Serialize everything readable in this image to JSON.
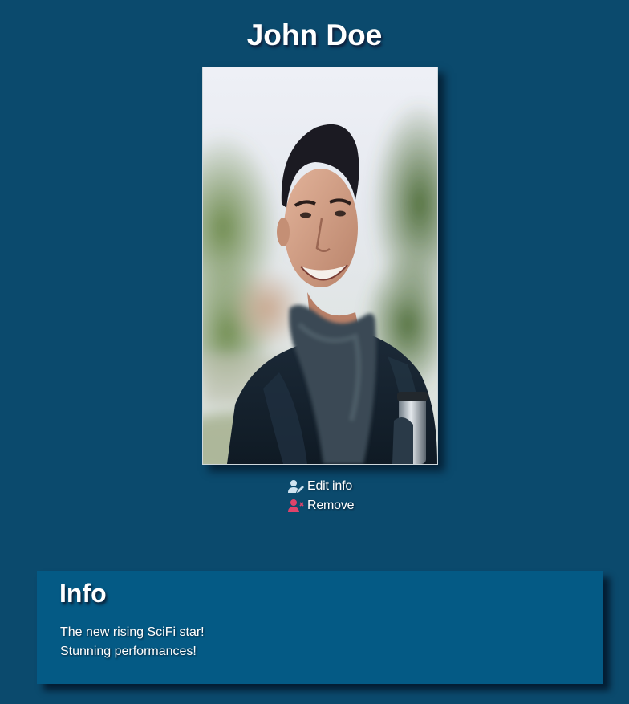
{
  "profile": {
    "name": "John Doe",
    "photo_alt": "Profile photo"
  },
  "actions": {
    "edit_label": "Edit info",
    "remove_label": "Remove",
    "edit_icon": "user-edit-icon",
    "remove_icon": "user-remove-icon",
    "edit_icon_color": "#cfe3f0",
    "remove_icon_color": "#e0436a"
  },
  "info": {
    "heading": "Info",
    "lines": [
      "The new rising SciFi star!",
      "Stunning performances!"
    ]
  },
  "colors": {
    "background": "#0b4a6d",
    "card": "#045a85"
  }
}
